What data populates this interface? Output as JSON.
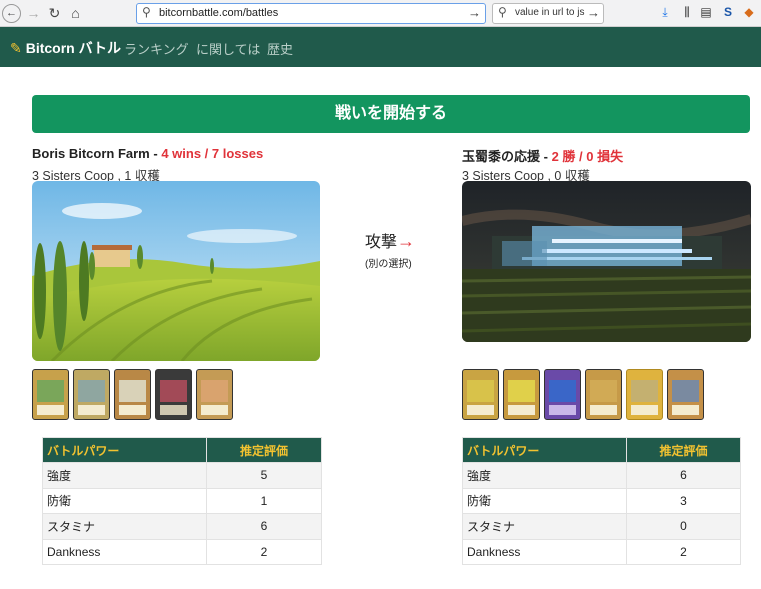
{
  "browser": {
    "url": "bitcornbattle.com/battles",
    "search_query": "value in url to js s",
    "back_glyph": "←",
    "forward_glyph": "→",
    "reload_glyph": "↻",
    "home_glyph": "⌂",
    "go_glyph": "→",
    "search_glyph": "⚲",
    "icons": [
      "download-icon",
      "library-icon",
      "sidebar-icon",
      "s-extension-icon",
      "extension-icon"
    ]
  },
  "navbar": {
    "brand": "Bitcorn バトル",
    "links": [
      "ランキング",
      "に関しては",
      "歴史"
    ]
  },
  "battle_button": "戦いを開始する",
  "left": {
    "name": "Boris Bitcorn Farm",
    "separator": " - ",
    "record": "4 wins / 7 losses",
    "subtitle": "3 Sisters Coop , 1 収穫",
    "table": {
      "headers": [
        "バトルパワー",
        "推定評価"
      ],
      "rows": [
        [
          "強度",
          "5"
        ],
        [
          "防衛",
          "1"
        ],
        [
          "スタミナ",
          "6"
        ],
        [
          "Dankness",
          "2"
        ]
      ]
    }
  },
  "right": {
    "name": "玉蜀黍の応援",
    "separator": " - ",
    "record": "2 勝 / 0 損失",
    "subtitle": "3 Sisters Coop , 0 収穫",
    "table": {
      "headers": [
        "バトルパワー",
        "推定評価"
      ],
      "rows": [
        [
          "強度",
          "6"
        ],
        [
          "防衛",
          "3"
        ],
        [
          "スタミナ",
          "0"
        ],
        [
          "Dankness",
          "2"
        ]
      ]
    }
  },
  "attack": {
    "label": "攻撃",
    "arrow": "→",
    "alt": "(別の選択)"
  },
  "colors": {
    "navbar": "#205a4b",
    "button": "#13955f",
    "record": "#e0333a",
    "table_header_text": "#f2c230"
  }
}
